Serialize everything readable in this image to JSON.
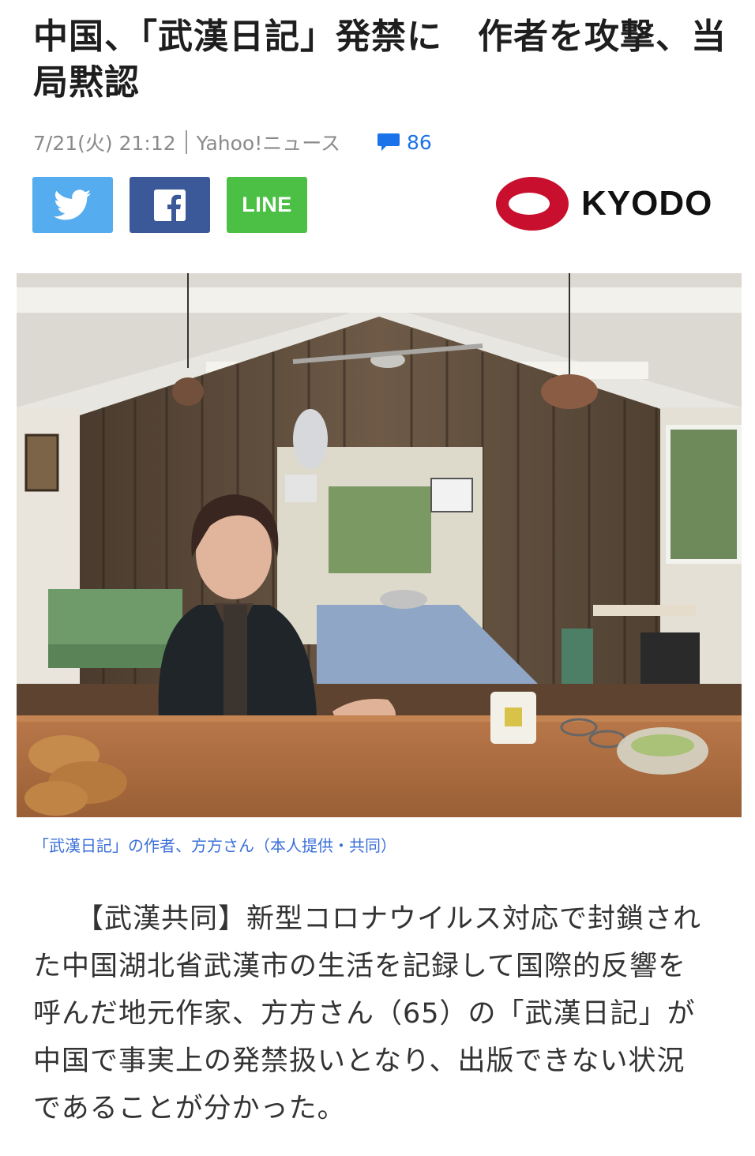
{
  "article": {
    "headline": "中国、「武漢日記」発禁に　作者を攻撃、当局黙認",
    "date": "7/21(火) 21:12",
    "source": "Yahoo!ニュース",
    "comment_count": "86"
  },
  "share": {
    "twitter_icon": "twitter-bird-icon",
    "facebook_icon": "facebook-f-icon",
    "line_label": "LINE"
  },
  "publisher": {
    "name": "KYODO",
    "logo_color": "#c8102e"
  },
  "photo": {
    "caption": "「武漢日記」の作者、方方さん（本人提供・共同）"
  },
  "body": {
    "text": "【武漢共同】新型コロナウイルス対応で封鎖された中国湖北省武漢市の生活を記録して国際的反響を呼んだ地元作家、方方さん（65）の「武漢日記」が中国で事実上の発禁扱いとなり、出版できない状況であることが分かった。"
  },
  "colors": {
    "link": "#1a73e8",
    "twitter": "#55acee",
    "facebook": "#3b5998",
    "line": "#4cc045"
  }
}
